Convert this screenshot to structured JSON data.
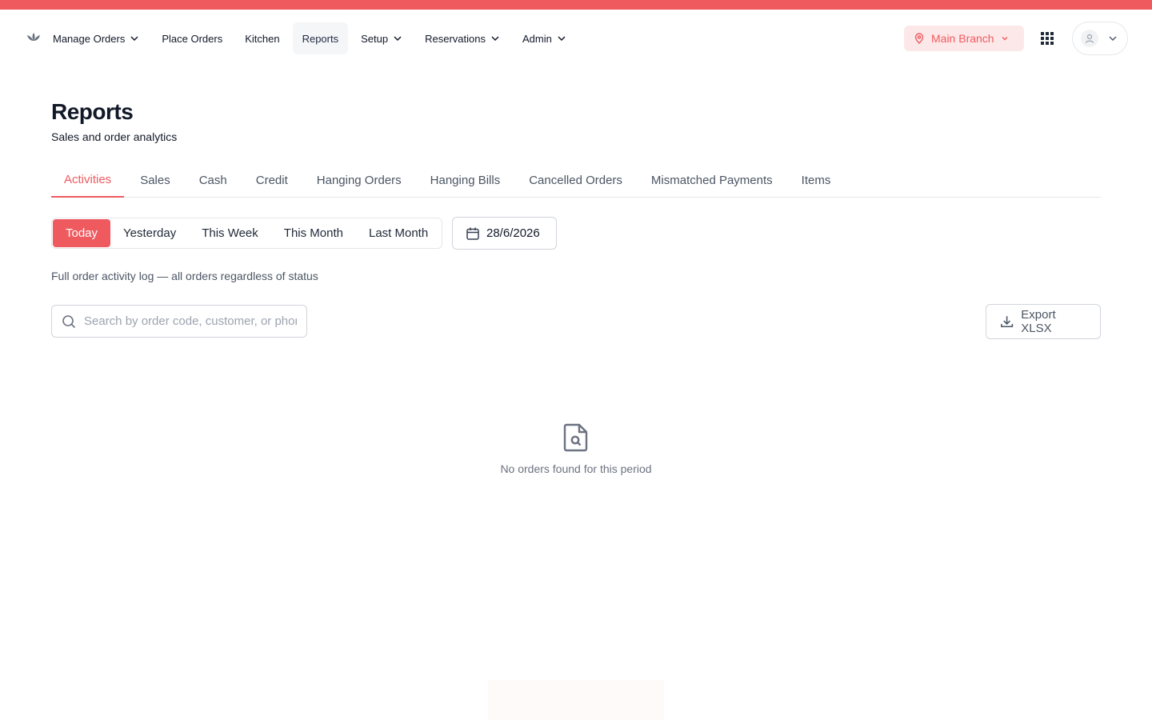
{
  "nav": {
    "items": [
      {
        "label": "Manage Orders",
        "has_dropdown": true
      },
      {
        "label": "Place Orders",
        "has_dropdown": false
      },
      {
        "label": "Kitchen",
        "has_dropdown": false
      },
      {
        "label": "Reports",
        "has_dropdown": false,
        "active": true
      },
      {
        "label": "Setup",
        "has_dropdown": true
      },
      {
        "label": "Reservations",
        "has_dropdown": true
      },
      {
        "label": "Admin",
        "has_dropdown": true
      }
    ],
    "branch_label": "Main Branch",
    "icons": {
      "logo": "lotus-logo-icon",
      "branch": "map-pin-icon",
      "apps": "grid-apps-icon",
      "user": "user-avatar-icon"
    }
  },
  "header": {
    "title": "Reports",
    "subtitle": "Sales and order analytics"
  },
  "tabs": [
    "Activities",
    "Sales",
    "Cash",
    "Credit",
    "Hanging Orders",
    "Hanging Bills",
    "Cancelled Orders",
    "Mismatched Payments",
    "Items"
  ],
  "active_tab": "Activities",
  "period": {
    "options": [
      "Today",
      "Yesterday",
      "This Week",
      "This Month",
      "Last Month"
    ],
    "selected": "Today",
    "date": "28/6/2026"
  },
  "description": "Full order activity log — all orders regardless of status",
  "search": {
    "placeholder": "Search by order code, customer, or phone",
    "value": ""
  },
  "export_label": "Export XLSX",
  "empty_state": {
    "icon": "file-search-icon",
    "message": "No orders found for this period"
  },
  "colors": {
    "accent": "#ef5a5f",
    "accent_soft": "#fde8e9",
    "text_primary": "#111827",
    "text_muted": "#6b7280",
    "border": "#e5e7eb"
  }
}
